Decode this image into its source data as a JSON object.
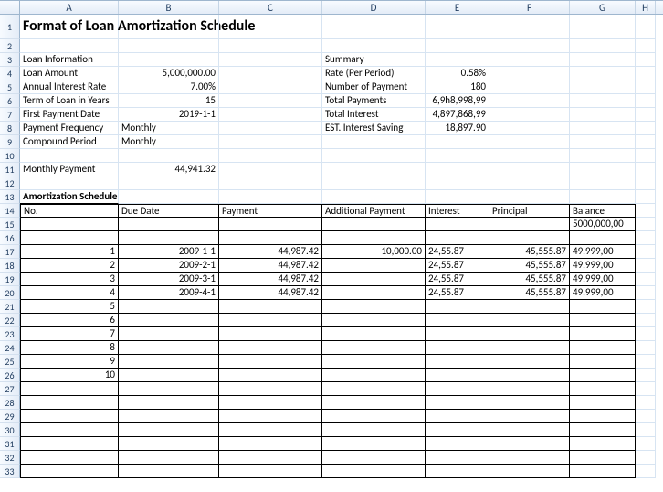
{
  "columns": [
    "A",
    "B",
    "C",
    "D",
    "E",
    "F",
    "G",
    "H"
  ],
  "row_numbers": [
    1,
    2,
    3,
    4,
    5,
    6,
    7,
    8,
    9,
    10,
    11,
    12,
    13,
    14,
    15,
    16,
    17,
    18,
    19,
    20,
    21,
    22,
    23,
    24,
    25,
    26,
    27,
    28,
    29,
    30,
    31,
    32,
    33
  ],
  "title": "Format of Loan Amortization Schedule",
  "loan_info": {
    "heading": "Loan Information",
    "rows": [
      {
        "label": "Loan Amount",
        "value": "5,000,000.00"
      },
      {
        "label": "Annual Interest Rate",
        "value": "7.00%"
      },
      {
        "label": "Term of Loan in Years",
        "value": "15"
      },
      {
        "label": "First Payment Date",
        "value": "2019-1-1"
      },
      {
        "label": "Payment Frequency",
        "value": "Monthly"
      },
      {
        "label": "Compound Period",
        "value": "Monthly"
      }
    ],
    "monthly_payment_label": "Monthly Payment",
    "monthly_payment_value": "44,941.32"
  },
  "summary": {
    "heading": "Summary",
    "rows": [
      {
        "label": "Rate (Per Period)",
        "value": "0.58%"
      },
      {
        "label": "Number of Payment",
        "value": "180"
      },
      {
        "label": "Total Payments",
        "value": "6,9h8,998,99"
      },
      {
        "label": "Total Interest",
        "value": "4,897,868,99"
      },
      {
        "label": "EST. Interest Saving",
        "value": "18,897.90"
      }
    ]
  },
  "schedule": {
    "heading": "Amortization Schedule",
    "headers": {
      "no": "No.",
      "due_date": "Due Date",
      "payment": "Payment",
      "additional_payment": "Additional Payment",
      "interest": "Interest",
      "principal": "Principal",
      "balance": "Balance"
    },
    "opening_balance": "5000,000,00",
    "rows": [
      {
        "no": "1",
        "due_date": "2009-1-1",
        "payment": "44,987.42",
        "additional_payment": "10,000.00",
        "interest": "24,55.87",
        "principal": "45,555.87",
        "balance": "49,999,00"
      },
      {
        "no": "2",
        "due_date": "2009-2-1",
        "payment": "44,987.42",
        "additional_payment": "",
        "interest": "24,55.87",
        "principal": "45,555.87",
        "balance": "49,999,00"
      },
      {
        "no": "3",
        "due_date": "2009-3-1",
        "payment": "44,987.42",
        "additional_payment": "",
        "interest": "24,55.87",
        "principal": "45,555.87",
        "balance": "49,999,00"
      },
      {
        "no": "4",
        "due_date": "2009-4-1",
        "payment": "44,987.42",
        "additional_payment": "",
        "interest": "24,55.87",
        "principal": "45,555.87",
        "balance": "49,999,00"
      },
      {
        "no": "5",
        "due_date": "",
        "payment": "",
        "additional_payment": "",
        "interest": "",
        "principal": "",
        "balance": ""
      },
      {
        "no": "6",
        "due_date": "",
        "payment": "",
        "additional_payment": "",
        "interest": "",
        "principal": "",
        "balance": ""
      },
      {
        "no": "7",
        "due_date": "",
        "payment": "",
        "additional_payment": "",
        "interest": "",
        "principal": "",
        "balance": ""
      },
      {
        "no": "8",
        "due_date": "",
        "payment": "",
        "additional_payment": "",
        "interest": "",
        "principal": "",
        "balance": ""
      },
      {
        "no": "9",
        "due_date": "",
        "payment": "",
        "additional_payment": "",
        "interest": "",
        "principal": "",
        "balance": ""
      },
      {
        "no": "10",
        "due_date": "",
        "payment": "",
        "additional_payment": "",
        "interest": "",
        "principal": "",
        "balance": ""
      }
    ]
  }
}
